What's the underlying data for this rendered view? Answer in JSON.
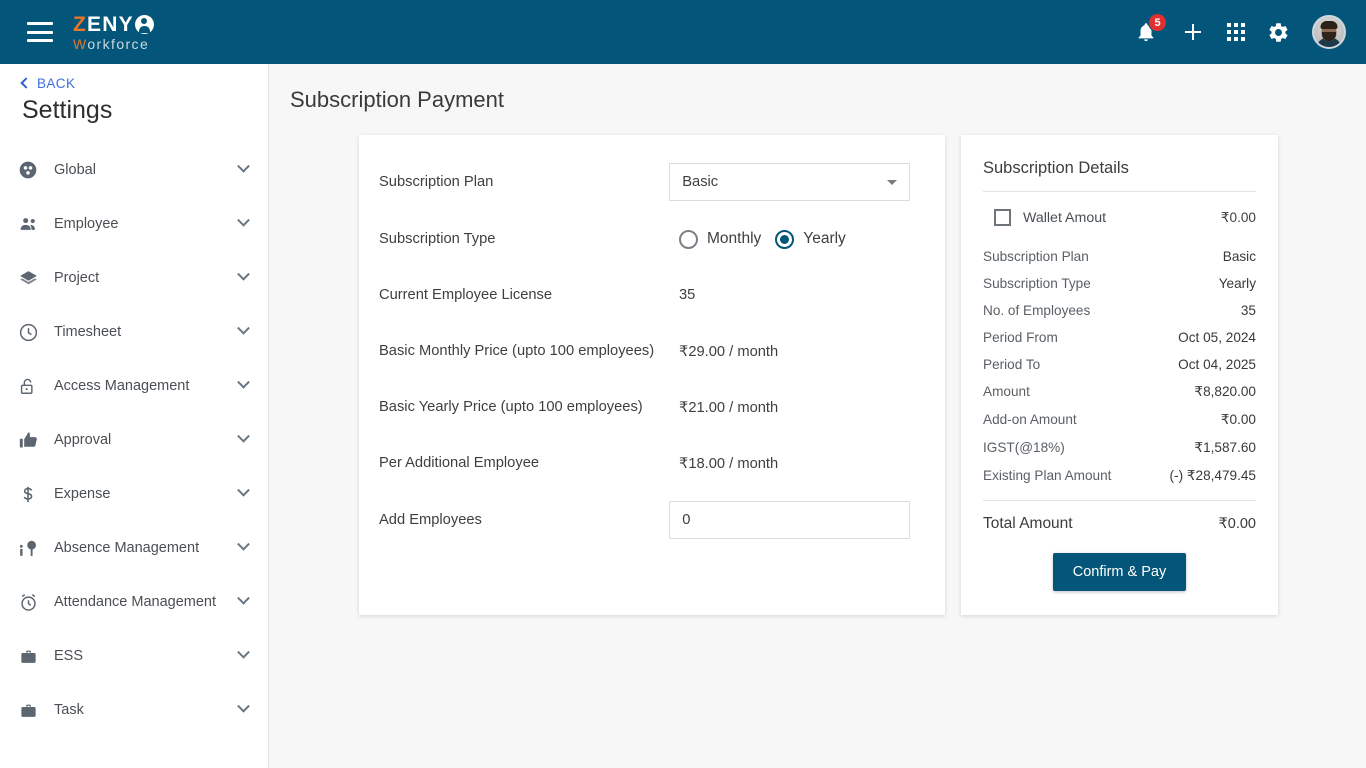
{
  "topbar": {
    "menu_icon": "hamburger-icon",
    "logo": {
      "part1": "Z",
      "part2": "ENY",
      "part3": "W",
      "part4": "orkforce"
    },
    "notification_count": "5",
    "icons": [
      "bell-icon",
      "plus-icon",
      "apps-grid-icon",
      "gear-icon",
      "avatar"
    ]
  },
  "sidebar": {
    "back_label": "BACK",
    "title": "Settings",
    "items": [
      {
        "label": "Global",
        "icon": "global-icon"
      },
      {
        "label": "Employee",
        "icon": "employee-icon"
      },
      {
        "label": "Project",
        "icon": "project-layers-icon"
      },
      {
        "label": "Timesheet",
        "icon": "clock-icon"
      },
      {
        "label": "Access Management",
        "icon": "unlock-icon"
      },
      {
        "label": "Approval",
        "icon": "thumbs-up-icon"
      },
      {
        "label": "Expense",
        "icon": "dollar-icon"
      },
      {
        "label": "Absence Management",
        "icon": "absence-tree-icon"
      },
      {
        "label": "Attendance Management",
        "icon": "alarm-clock-icon"
      },
      {
        "label": "ESS",
        "icon": "briefcase-icon"
      },
      {
        "label": "Task",
        "icon": "briefcase-icon"
      }
    ]
  },
  "main": {
    "page_title": "Subscription Payment",
    "form": {
      "plan_label": "Subscription Plan",
      "plan_value": "Basic",
      "type_label": "Subscription Type",
      "type_options": [
        {
          "label": "Monthly",
          "selected": false
        },
        {
          "label": "Yearly",
          "selected": true
        }
      ],
      "rows": [
        {
          "label": "Current Employee License",
          "value": "35"
        },
        {
          "label": "Basic Monthly Price (upto 100 employees)",
          "value": "₹29.00 / month"
        },
        {
          "label": "Basic Yearly Price (upto 100 employees)",
          "value": "₹21.00 / month"
        },
        {
          "label": "Per Additional Employee",
          "value": "₹18.00 / month"
        }
      ],
      "add_employees_label": "Add Employees",
      "add_employees_value": "0",
      "add_employees_placeholder": "0"
    },
    "details": {
      "title": "Subscription Details",
      "wallet_label": "Wallet Amout",
      "wallet_value": "₹0.00",
      "wallet_checked": false,
      "rows": [
        {
          "key": "Subscription Plan",
          "value": "Basic"
        },
        {
          "key": "Subscription Type",
          "value": "Yearly"
        },
        {
          "key": "No. of Employees",
          "value": "35"
        },
        {
          "key": "Period From",
          "value": "Oct 05, 2024"
        },
        {
          "key": "Period To",
          "value": "Oct 04, 2025"
        },
        {
          "key": "Amount",
          "value": "₹8,820.00"
        },
        {
          "key": "Add-on Amount",
          "value": "₹0.00"
        },
        {
          "key": "IGST(@18%)",
          "value": "₹1,587.60"
        },
        {
          "key": "Existing Plan Amount",
          "value": "(-) ₹28,479.45"
        }
      ],
      "total_label": "Total Amount",
      "total_value": "₹0.00",
      "pay_button": "Confirm & Pay"
    }
  },
  "colors": {
    "brand": "#03557a",
    "accent_orange": "#e8762c",
    "badge_red": "#e03030",
    "link_blue": "#3f6fd8",
    "page_bg": "#f7f7f8"
  }
}
